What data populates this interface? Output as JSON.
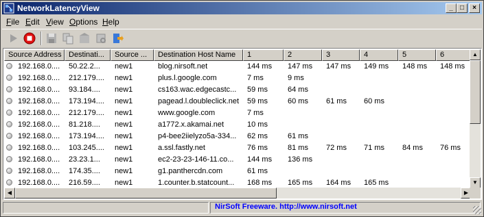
{
  "window": {
    "title": "NetworkLatencyView"
  },
  "menu": [
    {
      "accel": "F",
      "rest": "ile"
    },
    {
      "accel": "E",
      "rest": "dit"
    },
    {
      "accel": "V",
      "rest": "iew"
    },
    {
      "accel": "O",
      "rest": "ptions"
    },
    {
      "accel": "H",
      "rest": "elp"
    }
  ],
  "toolbar": [
    "play-icon",
    "stop-icon",
    "save-icon",
    "copy-icon",
    "html-report-icon",
    "properties-icon",
    "exit-icon"
  ],
  "columns": [
    "Source Address",
    "Destinati...",
    "Source ...",
    "Destination Host Name",
    "1",
    "2",
    "3",
    "4",
    "5",
    "6"
  ],
  "rows": [
    [
      "192.168.0....",
      "50.22.2...",
      "new1",
      "blog.nirsoft.net",
      "144 ms",
      "147 ms",
      "147 ms",
      "149 ms",
      "148 ms",
      "148 ms"
    ],
    [
      "192.168.0....",
      "212.179....",
      "new1",
      "plus.l.google.com",
      "7 ms",
      "9 ms",
      "",
      "",
      "",
      ""
    ],
    [
      "192.168.0....",
      "93.184....",
      "new1",
      "cs163.wac.edgecastc...",
      "59 ms",
      "64 ms",
      "",
      "",
      "",
      ""
    ],
    [
      "192.168.0....",
      "173.194....",
      "new1",
      "pagead.l.doubleclick.net",
      "59 ms",
      "60 ms",
      "61 ms",
      "60 ms",
      "",
      ""
    ],
    [
      "192.168.0....",
      "212.179....",
      "new1",
      "www.google.com",
      "7 ms",
      "",
      "",
      "",
      "",
      ""
    ],
    [
      "192.168.0....",
      "81.218....",
      "new1",
      "a1772.x.akamai.net",
      "10 ms",
      "",
      "",
      "",
      "",
      ""
    ],
    [
      "192.168.0....",
      "173.194....",
      "new1",
      "p4-bee2iielyzo5a-334...",
      "62 ms",
      "61 ms",
      "",
      "",
      "",
      ""
    ],
    [
      "192.168.0....",
      "103.245....",
      "new1",
      "a.ssl.fastly.net",
      "76 ms",
      "81 ms",
      "72 ms",
      "71 ms",
      "84 ms",
      "76 ms"
    ],
    [
      "192.168.0....",
      "23.23.1...",
      "new1",
      "ec2-23-23-146-11.co...",
      "144 ms",
      "136 ms",
      "",
      "",
      "",
      ""
    ],
    [
      "192.168.0....",
      "174.35....",
      "new1",
      "g1.panthercdn.com",
      "61 ms",
      "",
      "",
      "",
      "",
      ""
    ],
    [
      "192.168.0....",
      "216.59....",
      "new1",
      "1.counter.b.statcount...",
      "168 ms",
      "165 ms",
      "164 ms",
      "165 ms",
      "",
      ""
    ]
  ],
  "status": {
    "left": "",
    "link": "NirSoft Freeware.  http://www.nirsoft.net"
  }
}
